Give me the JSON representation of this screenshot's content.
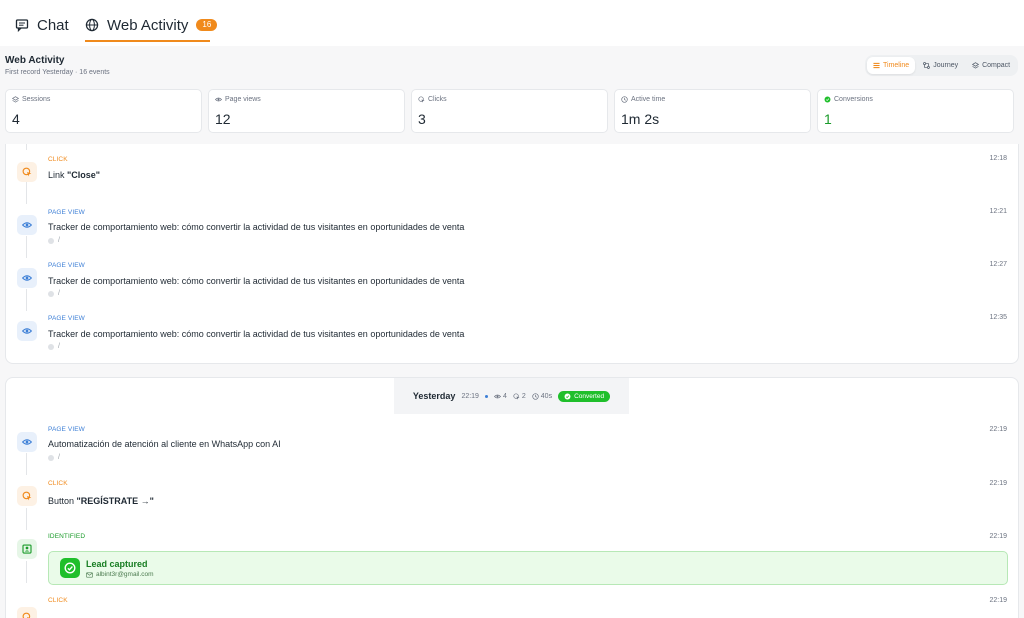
{
  "tabs": {
    "chat": "Chat",
    "web_activity": "Web Activity",
    "web_activity_count": "16"
  },
  "header": {
    "title": "Web Activity",
    "subtitle": "First record Yesterday · 16 events"
  },
  "view_switch": {
    "timeline": "Timeline",
    "journey": "Journey",
    "compact": "Compact"
  },
  "stats": [
    {
      "label": "Sessions",
      "value": "4"
    },
    {
      "label": "Page views",
      "value": "12"
    },
    {
      "label": "Clicks",
      "value": "3"
    },
    {
      "label": "Active time",
      "value": "1m 2s"
    },
    {
      "label": "Conversions",
      "value": "1"
    }
  ],
  "session1": {
    "events": [
      {
        "type": "CLICK",
        "time": "12:18",
        "prefix": "Link ",
        "target": "\"Close\""
      },
      {
        "type": "PAGE VIEW",
        "time": "12:21",
        "title": "Tracker de comportamiento web: cómo convertir la actividad de tus visitantes en oportunidades de venta",
        "path": "/"
      },
      {
        "type": "PAGE VIEW",
        "time": "12:27",
        "title": "Tracker de comportamiento web: cómo convertir la actividad de tus visitantes en oportunidades de venta",
        "path": "/"
      },
      {
        "type": "PAGE VIEW",
        "time": "12:35",
        "title": "Tracker de comportamiento web: cómo convertir la actividad de tus visitantes en oportunidades de venta",
        "path": "/"
      }
    ]
  },
  "session2": {
    "day": "Yesterday",
    "time": "22:19",
    "views": "4",
    "clicks": "2",
    "duration": "40s",
    "converted": "Converted",
    "events": [
      {
        "type": "PAGE VIEW",
        "time": "22:19",
        "title": "Automatización de atención al cliente en WhatsApp con AI",
        "path": "/"
      },
      {
        "type": "CLICK",
        "time": "22:19",
        "prefix": "Button ",
        "target": "\"REGÍSTRATE →\""
      },
      {
        "type": "IDENTIFIED",
        "time": "22:19"
      },
      {
        "type": "CLICK",
        "time": "22:19"
      }
    ],
    "lead": {
      "title": "Lead captured",
      "email": "albint3r@gmail.com"
    }
  },
  "colors": {
    "accent": "#f08a1c",
    "view": "#3d7fd6",
    "success": "#1fbf2b"
  }
}
